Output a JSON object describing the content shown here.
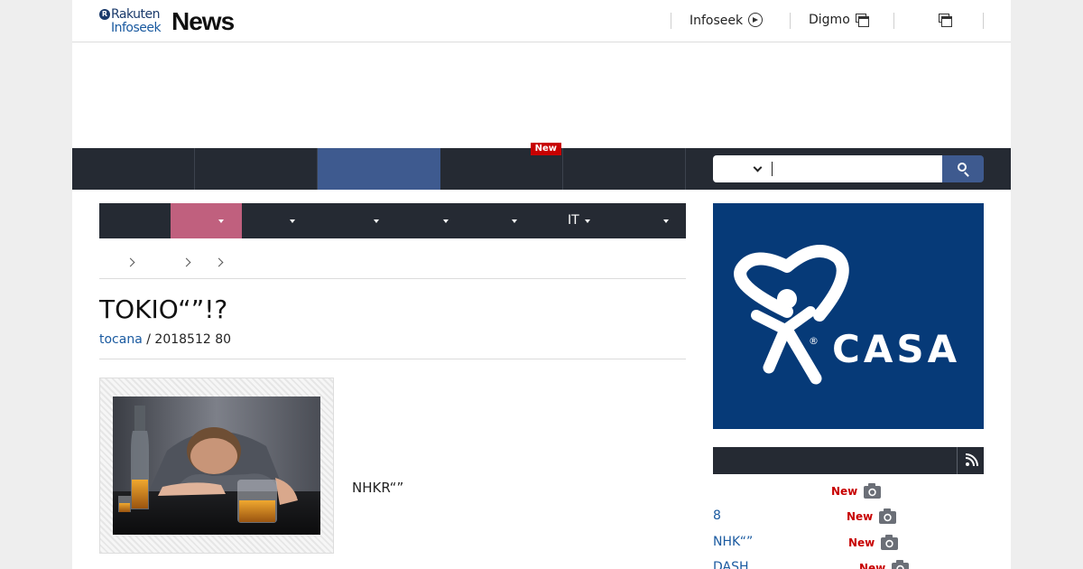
{
  "header": {
    "logo": {
      "brand": "Rakuten",
      "sub": "Infoseek",
      "product": "News",
      "mark": "R"
    },
    "links": [
      {
        "label": "Infoseek",
        "icon": "arrow-circle-icon"
      },
      {
        "label": "Digmo",
        "icon": "new-window-icon"
      },
      {
        "label": "",
        "icon": "new-window-icon"
      }
    ]
  },
  "nav": {
    "items": [
      "",
      "",
      "",
      "",
      ""
    ],
    "active_index": 2,
    "new_badge": "New"
  },
  "search": {
    "select_value": "",
    "query": ""
  },
  "categories": {
    "items": [
      "",
      "",
      "",
      "",
      "",
      "",
      "IT",
      ""
    ],
    "active_index": 1
  },
  "breadcrumb": [
    "",
    "",
    "",
    ""
  ],
  "article": {
    "title": "TOKIO“”!?",
    "source": "tocana",
    "separator": " / ",
    "meta_rest": "2018512 80",
    "summary": "NHKR“”"
  },
  "ad": {
    "brand": "CASA",
    "registered": "®"
  },
  "ranking": {
    "header": "",
    "items": [
      {
        "title": "",
        "badge": "New"
      },
      {
        "title": "8",
        "badge": "New"
      },
      {
        "title": "NHK“”",
        "badge": "New"
      },
      {
        "title": "DASH",
        "badge": "New"
      }
    ]
  },
  "colors": {
    "nav_bg": "#252a33",
    "nav_active": "#3e5a8f",
    "category_active": "#c0607e",
    "link_blue": "#1a5aa0",
    "new_red": "#c80000",
    "ad_bg": "#063a78"
  }
}
